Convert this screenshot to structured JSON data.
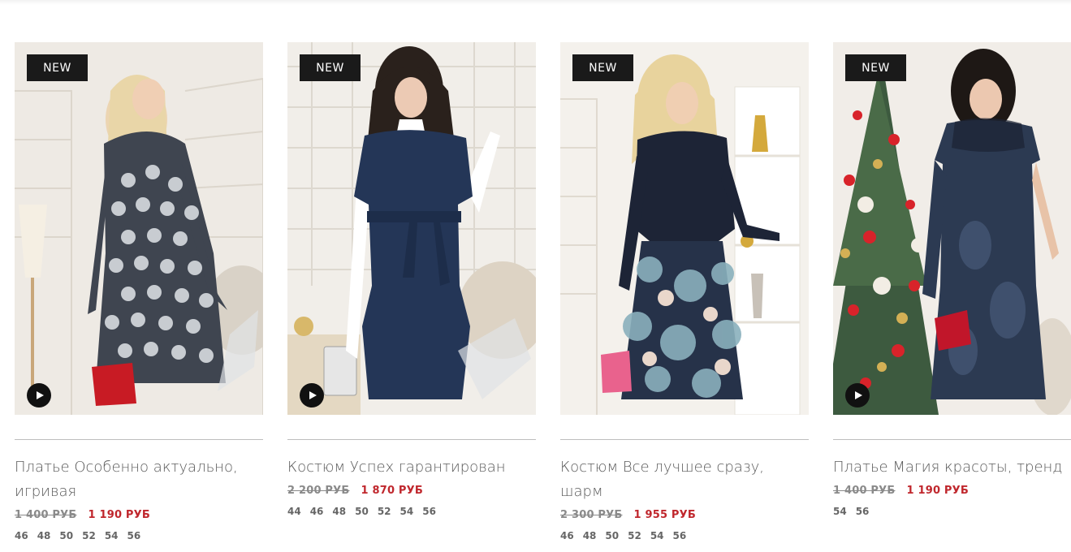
{
  "products": [
    {
      "badge": "NEW",
      "title": "Платье Особенно актуально, игривая",
      "old_price": "1 400 РУБ",
      "price": "1 190 РУБ",
      "sizes": [
        "46",
        "48",
        "50",
        "52",
        "54",
        "56"
      ],
      "has_video": true
    },
    {
      "badge": "NEW",
      "title": "Костюм Успех гарантирован",
      "old_price": "2 200 РУБ",
      "price": "1 870 РУБ",
      "sizes": [
        "44",
        "46",
        "48",
        "50",
        "52",
        "54",
        "56"
      ],
      "has_video": true
    },
    {
      "badge": "NEW",
      "title": "Костюм Все лучшее сразу, шарм",
      "old_price": "2 300 РУБ",
      "price": "1 955 РУБ",
      "sizes": [
        "46",
        "48",
        "50",
        "52",
        "54",
        "56"
      ],
      "has_video": false
    },
    {
      "badge": "NEW",
      "title": "Платье Магия красоты, тренд",
      "old_price": "1 400 РУБ",
      "price": "1 190 РУБ",
      "sizes": [
        "54",
        "56"
      ],
      "has_video": true
    }
  ],
  "colors": {
    "badge_bg": "#1a1a1a",
    "price_new": "#c0272d",
    "price_old": "#8a8a8a",
    "title": "#5a5a5a"
  },
  "icons": {
    "play": "play-icon"
  }
}
